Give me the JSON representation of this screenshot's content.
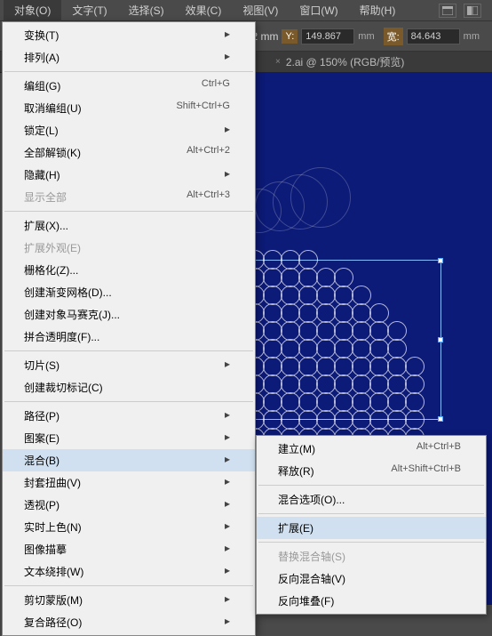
{
  "menubar": {
    "items": [
      "对象(O)",
      "文字(T)",
      "选择(S)",
      "效果(C)",
      "视图(V)",
      "窗口(W)",
      "帮助(H)"
    ]
  },
  "toolbar": {
    "y_label": "Y:",
    "y_value": "149.867",
    "x_suffix": "2 mm",
    "w_label": "宽:",
    "w_value": "84.643",
    "unit": "mm"
  },
  "tabs": {
    "active_prefix": "×",
    "active": "2.ai @ 150% (RGB/预览)"
  },
  "menu1": {
    "groups": [
      [
        {
          "label": "变换(T)",
          "arrow": true
        },
        {
          "label": "排列(A)",
          "arrow": true
        }
      ],
      [
        {
          "label": "编组(G)",
          "shortcut": "Ctrl+G"
        },
        {
          "label": "取消编组(U)",
          "shortcut": "Shift+Ctrl+G"
        },
        {
          "label": "锁定(L)",
          "arrow": true
        },
        {
          "label": "全部解锁(K)",
          "shortcut": "Alt+Ctrl+2"
        },
        {
          "label": "隐藏(H)",
          "arrow": true
        },
        {
          "label": "显示全部",
          "shortcut": "Alt+Ctrl+3",
          "disabled": true
        }
      ],
      [
        {
          "label": "扩展(X)..."
        },
        {
          "label": "扩展外观(E)",
          "disabled": true
        },
        {
          "label": "栅格化(Z)..."
        },
        {
          "label": "创建渐变网格(D)..."
        },
        {
          "label": "创建对象马赛克(J)..."
        },
        {
          "label": "拼合透明度(F)..."
        }
      ],
      [
        {
          "label": "切片(S)",
          "arrow": true
        },
        {
          "label": "创建裁切标记(C)"
        }
      ],
      [
        {
          "label": "路径(P)",
          "arrow": true
        },
        {
          "label": "图案(E)",
          "arrow": true
        },
        {
          "label": "混合(B)",
          "arrow": true,
          "highlight": true
        },
        {
          "label": "封套扭曲(V)",
          "arrow": true
        },
        {
          "label": "透视(P)",
          "arrow": true
        },
        {
          "label": "实时上色(N)",
          "arrow": true
        },
        {
          "label": "图像描摹",
          "arrow": true
        },
        {
          "label": "文本绕排(W)",
          "arrow": true
        }
      ],
      [
        {
          "label": "剪切蒙版(M)",
          "arrow": true
        },
        {
          "label": "复合路径(O)",
          "arrow": true
        }
      ]
    ]
  },
  "menu2": {
    "groups": [
      [
        {
          "label": "建立(M)",
          "shortcut": "Alt+Ctrl+B"
        },
        {
          "label": "释放(R)",
          "shortcut": "Alt+Shift+Ctrl+B"
        }
      ],
      [
        {
          "label": "混合选项(O)..."
        }
      ],
      [
        {
          "label": "扩展(E)",
          "highlight": true
        }
      ],
      [
        {
          "label": "替换混合轴(S)",
          "disabled": true
        },
        {
          "label": "反向混合轴(V)"
        },
        {
          "label": "反向堆叠(F)"
        }
      ]
    ]
  }
}
